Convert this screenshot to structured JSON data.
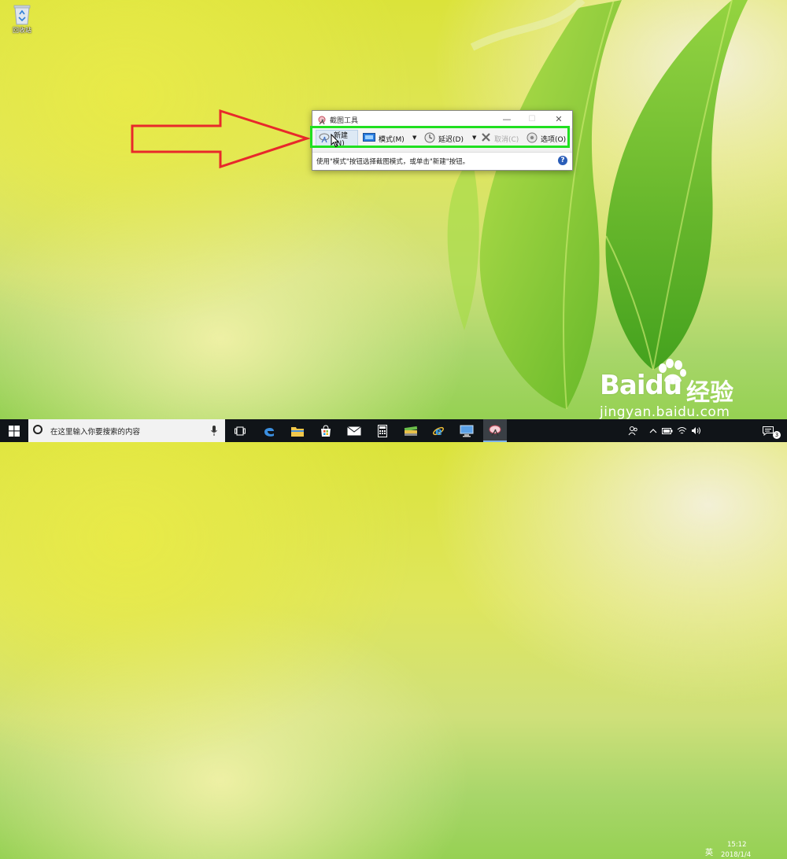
{
  "desktop": {
    "recycle_bin_label": "回收站"
  },
  "snipping_tool": {
    "title": "截图工具",
    "toolbar": {
      "new_label": "新建(N)",
      "mode_label": "模式(M)",
      "delay_label": "延迟(D)",
      "cancel_label": "取消(C)",
      "options_label": "选项(O)"
    },
    "status_message": "使用\"模式\"按钮选择截图模式，或单击\"新建\"按钮。",
    "help_symbol": "?",
    "highlight_color": "#20e020"
  },
  "annotation": {
    "arrow_color": "#e8292b"
  },
  "watermark": {
    "logo_text": "Baidu",
    "logo_suffix": "经验",
    "url": "jingyan.baidu.com"
  },
  "taskbar": {
    "search_placeholder": "在这里输入你要搜索的内容",
    "pinned_apps": [
      "task-view-icon",
      "edge-icon",
      "file-explorer-icon",
      "store-icon",
      "mail-icon",
      "calculator-icon",
      "books-icon",
      "internet-explorer-icon",
      "computer-icon",
      "snipping-tool-icon"
    ],
    "ime_label": "英",
    "time": "15:12",
    "date": "2018/1/4",
    "notification_count": "3"
  }
}
